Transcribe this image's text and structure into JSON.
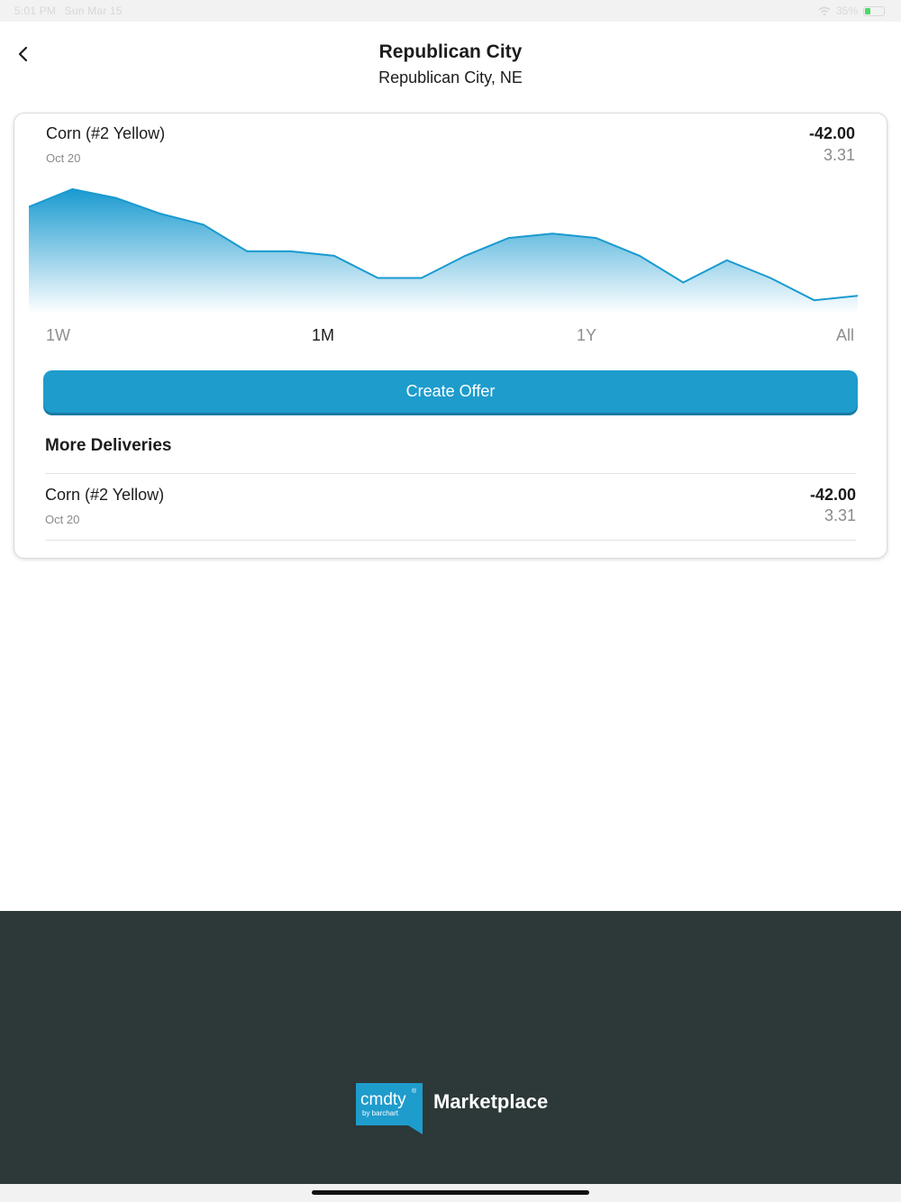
{
  "status_bar": {
    "time": "5:01 PM",
    "date": "Sun Mar 15",
    "battery": "35%"
  },
  "header": {
    "title": "Republican City",
    "subtitle": "Republican City, NE"
  },
  "commodity": {
    "name": "Corn (#2 Yellow)",
    "delivery_date": "Oct 20",
    "basis": "-42.00",
    "price": "3.31"
  },
  "chart_data": {
    "type": "area",
    "title": "",
    "xlabel": "",
    "ylabel": "",
    "x": [
      0,
      1,
      2,
      3,
      4,
      5,
      6,
      7,
      8,
      9,
      10,
      11,
      12,
      13,
      14,
      15,
      16,
      17,
      18,
      19
    ],
    "values": [
      96,
      100,
      98,
      94.5,
      92,
      86,
      86,
      85,
      80,
      80,
      85,
      89,
      90,
      89,
      85,
      79,
      84,
      80,
      75,
      76
    ],
    "ylim": [
      72,
      102
    ],
    "grid": false,
    "legend": "none",
    "line_color": "#1a9ad0",
    "fill_color_top": "#1a9ad0",
    "fill_color_bottom": "#ffffff"
  },
  "range_tabs": [
    {
      "label": "1W"
    },
    {
      "label": "1M"
    },
    {
      "label": "1Y"
    },
    {
      "label": "All"
    }
  ],
  "selected_range": "1M",
  "actions": {
    "create_offer_label": "Create Offer"
  },
  "more_deliveries": {
    "title": "More Deliveries",
    "items": [
      {
        "name": "Corn (#2 Yellow)",
        "date": "Oct 20",
        "basis": "-42.00",
        "price": "3.31"
      }
    ]
  },
  "footer": {
    "logo_text": "cmdty",
    "logo_sub": "by barchart",
    "logo_reg": "®",
    "brand": "Marketplace",
    "logo_color": "#1e9ccc"
  }
}
